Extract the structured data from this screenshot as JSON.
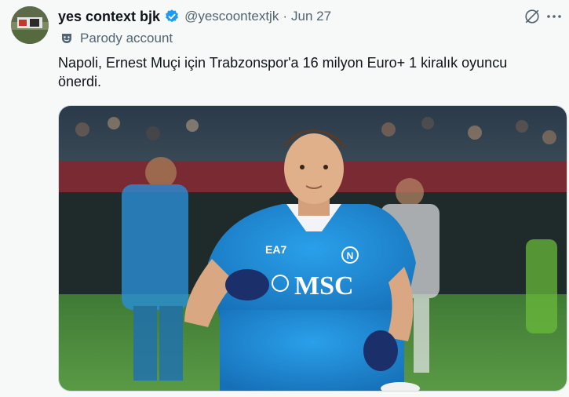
{
  "tweet": {
    "display_name": "yes context bjk",
    "handle": "@yescoontextjk",
    "separator": "·",
    "date": "Jun 27",
    "label": "Parody account",
    "text": "Napoli, Ernest Muçi için Trabzonspor'a 16 milyon Euro+ 1 kiralık oyuncu önerdi.",
    "jersey_sponsor": "MSC",
    "jersey_brand": "EA7",
    "icons": {
      "verified": "verified-badge-icon",
      "grok": "grok-icon",
      "more": "more-icon",
      "parody": "parody-mask-icon"
    }
  },
  "colors": {
    "verified": "#1d9bf0",
    "text": "#0f1419",
    "secondary": "#536471",
    "background": "#f7f9f9",
    "jersey": "#1f8ed8"
  }
}
